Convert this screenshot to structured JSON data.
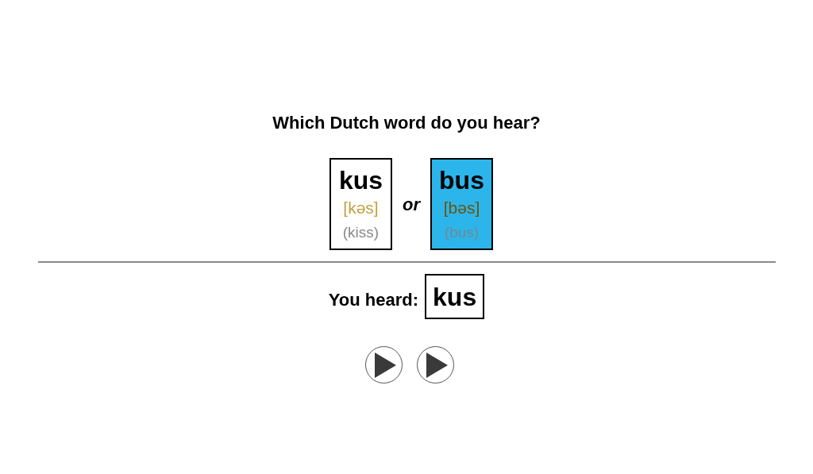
{
  "question": "Which Dutch word do you hear?",
  "options": [
    {
      "word": "kus",
      "pronunciation": "[kəs]",
      "meaning": "(kiss)",
      "selected": false
    },
    {
      "word": "bus",
      "pronunciation": "[bəs]",
      "meaning": "(bus)",
      "selected": true
    }
  ],
  "separator": "or",
  "result": {
    "label": "You heard:",
    "word": "kus"
  },
  "play_buttons": [
    {
      "kind": "play"
    },
    {
      "kind": "play"
    }
  ]
}
